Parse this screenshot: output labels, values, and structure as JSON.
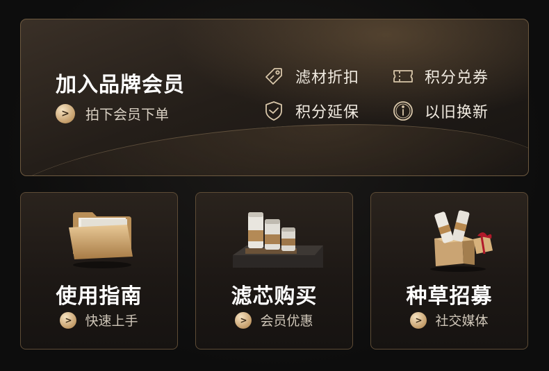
{
  "member": {
    "title": "加入品牌会员",
    "subtitle": "拍下会员下单",
    "perks": [
      {
        "label": "滤材折扣",
        "icon": "tag-icon"
      },
      {
        "label": "积分兑券",
        "icon": "ticket-icon"
      },
      {
        "label": "积分延保",
        "icon": "shield-check-icon"
      },
      {
        "label": "以旧换新",
        "icon": "info-circle-icon"
      }
    ]
  },
  "tiles": [
    {
      "title": "使用指南",
      "subtitle": "快速上手",
      "icon": "folder-icon"
    },
    {
      "title": "滤芯购买",
      "subtitle": "会员优惠",
      "icon": "filter-cartridge-icon"
    },
    {
      "title": "种草招募",
      "subtitle": "社交媒体",
      "icon": "gift-box-icon"
    }
  ],
  "colors": {
    "accent_gold": "#c49d6a",
    "border": "#6e5a40",
    "background": "#0d0d0d"
  }
}
